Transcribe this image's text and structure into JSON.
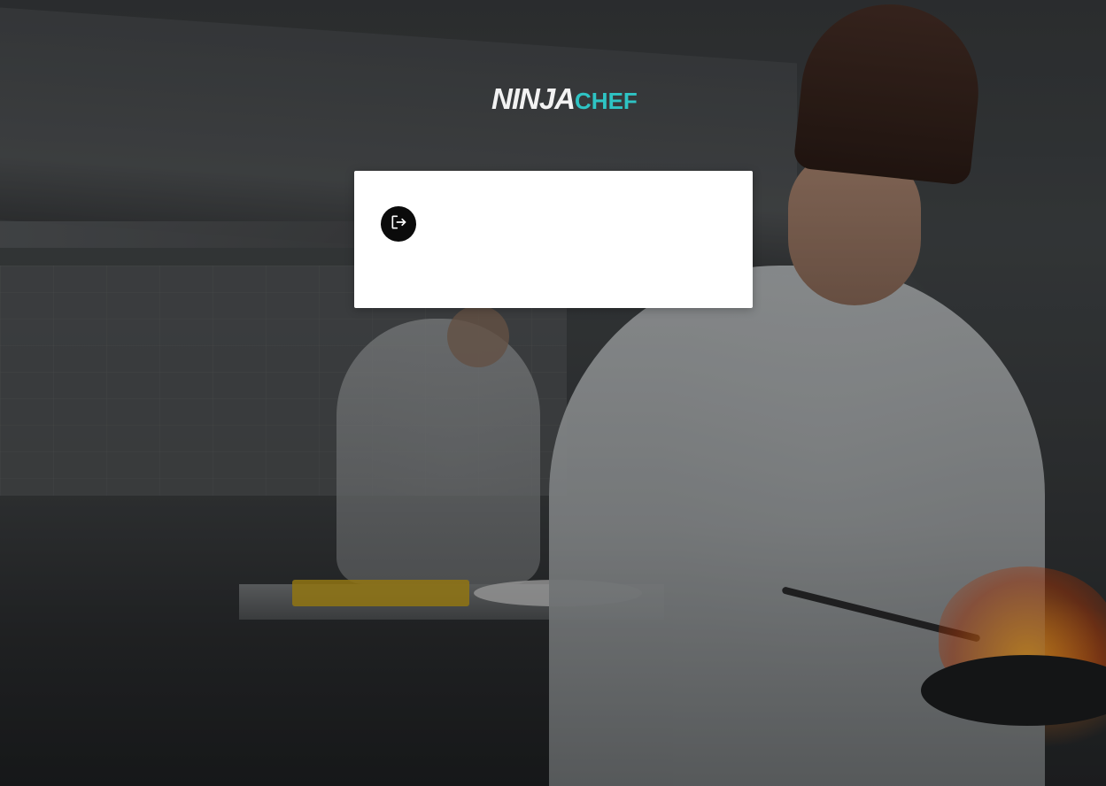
{
  "brand": {
    "logo_part1": "NINJA",
    "logo_part2": "CHEF",
    "logo_accent_color": "#2ec4c4"
  },
  "card": {
    "logout_icon": "logout-icon",
    "background_color": "#ffffff",
    "button_color": "#0b0b0b"
  }
}
